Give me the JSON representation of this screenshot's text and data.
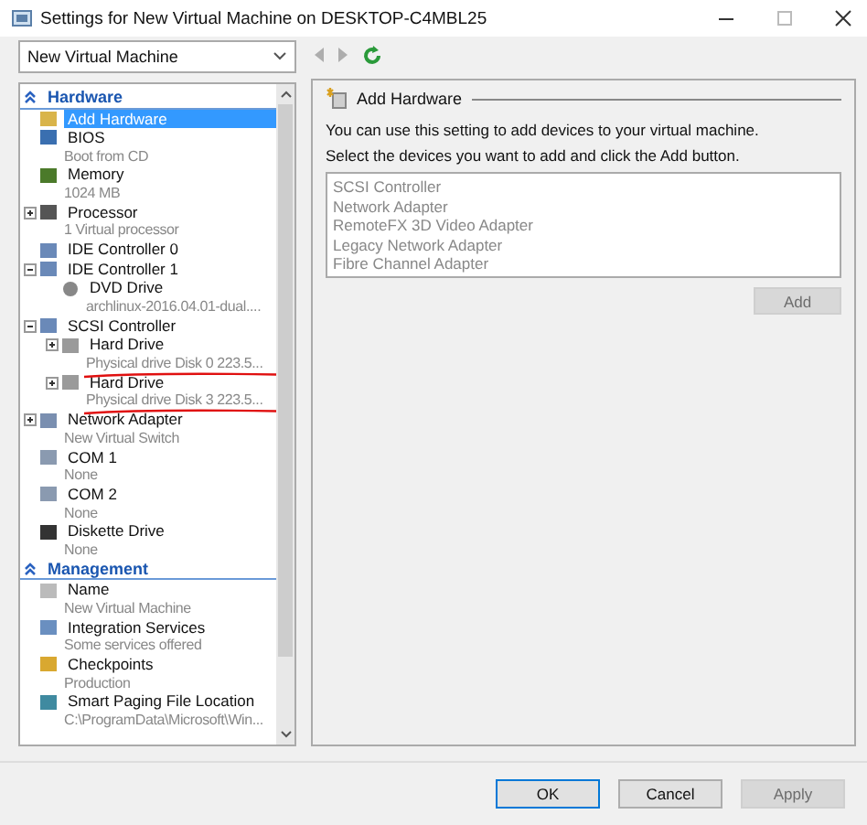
{
  "window": {
    "title": "Settings for New Virtual Machine on DESKTOP-C4MBL25"
  },
  "toolbar": {
    "vm_selector": "New Virtual Machine",
    "back_disabled": true,
    "forward_disabled": true
  },
  "sidebar": {
    "sections": [
      {
        "title": "Hardware",
        "items": [
          {
            "kind": "add",
            "name": "Add Hardware",
            "selected": true
          },
          {
            "kind": "chip",
            "name": "BIOS",
            "detail": "Boot from CD",
            "selected": false
          },
          {
            "kind": "memory",
            "name": "Memory",
            "detail": "1024 MB",
            "selected": false
          },
          {
            "kind": "processor",
            "name": "Processor",
            "detail": "1 Virtual processor",
            "selected": false,
            "expanded": false
          },
          {
            "kind": "controller",
            "name": "IDE Controller 0",
            "selected": false
          },
          {
            "kind": "controller",
            "name": "IDE Controller 1",
            "selected": false,
            "expanded": true,
            "children": [
              {
                "kind": "disc",
                "name": "DVD Drive",
                "detail": "archlinux-2016.04.01-dual....",
                "selected": false
              }
            ]
          },
          {
            "kind": "controller",
            "name": "SCSI Controller",
            "selected": false,
            "expanded": true,
            "children": [
              {
                "kind": "drive",
                "name": "Hard Drive",
                "detail": "Physical drive Disk 0 223.5...",
                "selected": false,
                "expanded": false,
                "underlined": true
              },
              {
                "kind": "drive",
                "name": "Hard Drive",
                "detail": "Physical drive Disk 3 223.5...",
                "selected": false,
                "expanded": false,
                "underlined": true
              }
            ]
          },
          {
            "kind": "network",
            "name": "Network Adapter",
            "detail": "New Virtual Switch",
            "selected": false,
            "expanded": false
          },
          {
            "kind": "port",
            "name": "COM 1",
            "detail": "None",
            "selected": false
          },
          {
            "kind": "port",
            "name": "COM 2",
            "detail": "None",
            "selected": false
          },
          {
            "kind": "floppy",
            "name": "Diskette Drive",
            "detail": "None",
            "selected": false
          }
        ]
      },
      {
        "title": "Management",
        "items": [
          {
            "kind": "name",
            "name": "Name",
            "detail": "New Virtual Machine",
            "selected": false
          },
          {
            "kind": "services",
            "name": "Integration Services",
            "detail": "Some services offered",
            "selected": false
          },
          {
            "kind": "checkpoint",
            "name": "Checkpoints",
            "detail": "Production",
            "selected": false
          },
          {
            "kind": "paging",
            "name": "Smart Paging File Location",
            "detail": "C:\\ProgramData\\Microsoft\\Win...",
            "selected": false
          }
        ]
      }
    ]
  },
  "panel": {
    "heading": "Add Hardware",
    "lines": [
      "You can use this setting to add devices to your virtual machine.",
      "Select the devices you want to add and click the Add button."
    ],
    "devices": [
      "SCSI Controller",
      "Network Adapter",
      "RemoteFX 3D Video Adapter",
      "Legacy Network Adapter",
      "Fibre Channel Adapter"
    ],
    "add_button": {
      "label": "Add",
      "disabled": true
    }
  },
  "buttons": [
    {
      "label": "OK",
      "disabled": false,
      "default": true
    },
    {
      "label": "Cancel",
      "disabled": false,
      "default": false
    },
    {
      "label": "Apply",
      "disabled": true,
      "default": false
    }
  ]
}
